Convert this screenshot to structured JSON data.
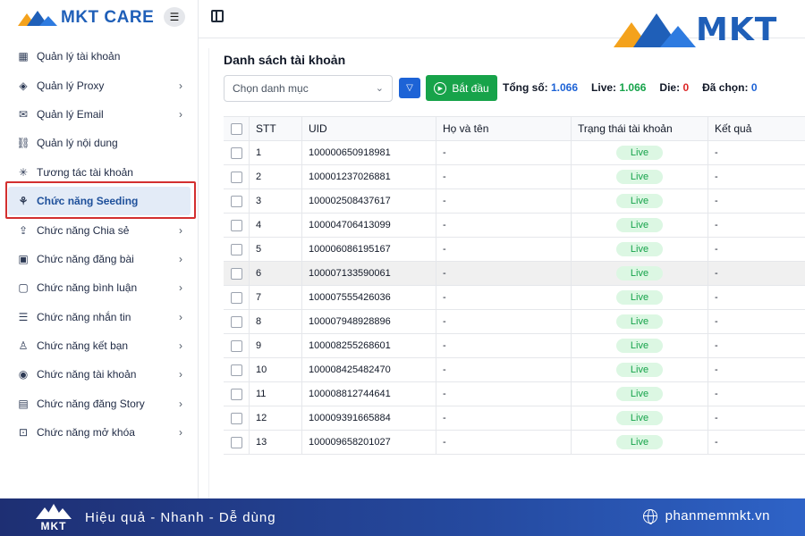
{
  "app": {
    "brand": "MKT CARE",
    "logo_text": "MKT"
  },
  "sidebar": {
    "items": [
      {
        "label": "Quản lý tài khoản",
        "icon": "grid-icon",
        "chevron": false,
        "active": false
      },
      {
        "label": "Quản lý Proxy",
        "icon": "layers-icon",
        "chevron": true,
        "active": false
      },
      {
        "label": "Quản lý Email",
        "icon": "mail-icon",
        "chevron": true,
        "active": false
      },
      {
        "label": "Quản lý nội dung",
        "icon": "link-icon",
        "chevron": false,
        "active": false
      },
      {
        "label": "Tương tác tài khoản",
        "icon": "sparkle-icon",
        "chevron": false,
        "active": false
      },
      {
        "label": "Chức năng Seeding",
        "icon": "sprout-icon",
        "chevron": false,
        "active": true
      },
      {
        "label": "Chức năng Chia sẻ",
        "icon": "share-icon",
        "chevron": true,
        "active": false
      },
      {
        "label": "Chức năng đăng bài",
        "icon": "post-icon",
        "chevron": true,
        "active": false
      },
      {
        "label": "Chức năng bình luận",
        "icon": "comment-icon",
        "chevron": true,
        "active": false
      },
      {
        "label": "Chức năng nhắn tin",
        "icon": "chat-icon",
        "chevron": true,
        "active": false
      },
      {
        "label": "Chức năng kết bạn",
        "icon": "user-plus-icon",
        "chevron": true,
        "active": false
      },
      {
        "label": "Chức năng tài khoản",
        "icon": "user-circle-icon",
        "chevron": true,
        "active": false
      },
      {
        "label": "Chức năng đăng Story",
        "icon": "story-icon",
        "chevron": true,
        "active": false
      },
      {
        "label": "Chức năng mở khóa",
        "icon": "lock-icon",
        "chevron": true,
        "active": false
      }
    ]
  },
  "main": {
    "title": "Danh sách tài khoản",
    "category_placeholder": "Chọn danh mục",
    "start_label": "Bắt đầu",
    "stats": {
      "total_label": "Tổng số:",
      "total": "1.066",
      "live_label": "Live:",
      "live": "1.066",
      "die_label": "Die:",
      "die": "0",
      "selected_label": "Đã chọn:",
      "selected": "0"
    },
    "table": {
      "headers": [
        "STT",
        "UID",
        "Họ và tên",
        "Trạng thái tài khoản",
        "Kết quả"
      ],
      "rows": [
        {
          "stt": "1",
          "uid": "100000650918981",
          "name": "-",
          "status": "Live",
          "result": "-"
        },
        {
          "stt": "2",
          "uid": "100001237026881",
          "name": "-",
          "status": "Live",
          "result": "-"
        },
        {
          "stt": "3",
          "uid": "100002508437617",
          "name": "-",
          "status": "Live",
          "result": "-"
        },
        {
          "stt": "4",
          "uid": "100004706413099",
          "name": "-",
          "status": "Live",
          "result": "-"
        },
        {
          "stt": "5",
          "uid": "100006086195167",
          "name": "-",
          "status": "Live",
          "result": "-"
        },
        {
          "stt": "6",
          "uid": "100007133590061",
          "name": "-",
          "status": "Live",
          "result": "-"
        },
        {
          "stt": "7",
          "uid": "100007555426036",
          "name": "-",
          "status": "Live",
          "result": "-"
        },
        {
          "stt": "8",
          "uid": "100007948928896",
          "name": "-",
          "status": "Live",
          "result": "-"
        },
        {
          "stt": "9",
          "uid": "100008255268601",
          "name": "-",
          "status": "Live",
          "result": "-"
        },
        {
          "stt": "10",
          "uid": "100008425482470",
          "name": "-",
          "status": "Live",
          "result": "-"
        },
        {
          "stt": "11",
          "uid": "100008812744641",
          "name": "-",
          "status": "Live",
          "result": "-"
        },
        {
          "stt": "12",
          "uid": "100009391665884",
          "name": "-",
          "status": "Live",
          "result": "-"
        },
        {
          "stt": "13",
          "uid": "100009658201027",
          "name": "-",
          "status": "Live",
          "result": "-"
        }
      ]
    }
  },
  "footer": {
    "logo_text": "MKT",
    "slogan": "Hiệu quả - Nhanh - Dễ dùng",
    "website": "phanmemmkt.vn"
  },
  "colors": {
    "brand_blue": "#1f5fb8",
    "start_green": "#17a34a",
    "filter_blue": "#1d63d6",
    "live_bg": "#dcf7e3",
    "highlight_red": "#d32f2f"
  }
}
